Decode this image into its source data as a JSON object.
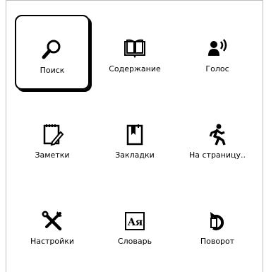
{
  "menu": {
    "items": [
      {
        "label": "Поиск",
        "icon": "search-icon"
      },
      {
        "label": "Содержание",
        "icon": "book-icon"
      },
      {
        "label": "Голос",
        "icon": "voice-icon"
      },
      {
        "label": "Заметки",
        "icon": "notes-icon"
      },
      {
        "label": "Закладки",
        "icon": "bookmark-icon"
      },
      {
        "label": "На страницу..",
        "icon": "walk-icon"
      },
      {
        "label": "Настройки",
        "icon": "tools-icon"
      },
      {
        "label": "Словарь",
        "icon": "dictionary-icon"
      },
      {
        "label": "Поворот",
        "icon": "rotate-icon"
      }
    ],
    "selected_index": 0
  }
}
